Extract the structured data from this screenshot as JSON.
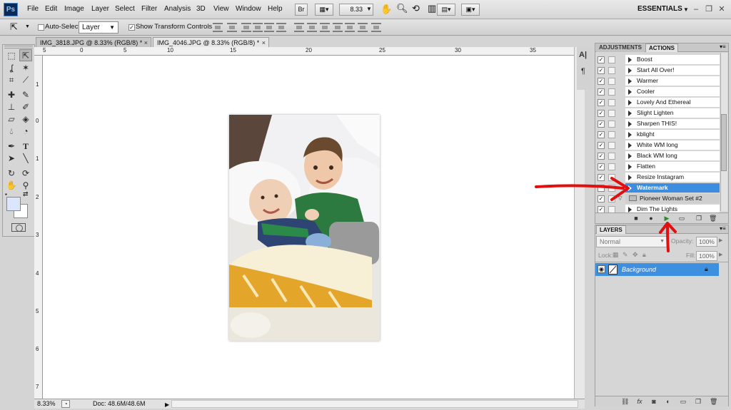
{
  "app": {
    "logo": "Ps",
    "workspace": "ESSENTIALS"
  },
  "menu": [
    "File",
    "Edit",
    "Image",
    "Layer",
    "Select",
    "Filter",
    "Analysis",
    "3D",
    "View",
    "Window",
    "Help"
  ],
  "menubar_controls": {
    "bridge": "Br",
    "zoom": "8.33"
  },
  "options": {
    "auto_select_label": "Auto-Select:",
    "auto_select_value": "Layer",
    "show_transform_label": "Show Transform Controls"
  },
  "tabs": [
    {
      "label": "IMG_3818.JPG @ 8.33% (RGB/8) *",
      "close": "×"
    },
    {
      "label": "IMG_4046.JPG @ 8.33% (RGB/8) *",
      "close": "×"
    }
  ],
  "rulers": {
    "h": [
      "5",
      "0",
      "5",
      "10",
      "15",
      "20",
      "25",
      "30",
      "35"
    ],
    "v": [
      "1",
      "0",
      "1",
      "2",
      "3",
      "4",
      "5",
      "6",
      "7"
    ]
  },
  "status": {
    "zoom": "8.33%",
    "doc": "Doc: 48.6M/48.6M"
  },
  "panels": {
    "adjustments_tab": "ADJUSTMENTS",
    "actions_tab": "ACTIONS",
    "layers_tab": "LAYERS"
  },
  "actions": [
    {
      "label": "Boost",
      "checked": true
    },
    {
      "label": "Start All Over!",
      "checked": true
    },
    {
      "label": "Warmer",
      "checked": true
    },
    {
      "label": "Cooler",
      "checked": true
    },
    {
      "label": "Lovely And Ethereal",
      "checked": true
    },
    {
      "label": "Slight Lighten",
      "checked": true
    },
    {
      "label": "Sharpen THIS!",
      "checked": true
    },
    {
      "label": "kblight",
      "checked": true
    },
    {
      "label": "White WM long",
      "checked": true
    },
    {
      "label": "Black WM long",
      "checked": true
    },
    {
      "label": "Flatten",
      "checked": true
    },
    {
      "label": "Resize Instagram",
      "checked": true
    },
    {
      "label": "Watermark",
      "checked": false,
      "selected": true
    },
    {
      "label": "Pioneer Woman Set #2",
      "checked": true,
      "set": true
    },
    {
      "label": "Dim The Lights",
      "checked": true
    }
  ],
  "layers": {
    "blend_mode": "Normal",
    "opacity_label": "Opacity:",
    "opacity_value": "100%",
    "lock_label": "Lock:",
    "fill_label": "Fill:",
    "fill_value": "100%",
    "items": [
      {
        "name": "Background",
        "visible": true,
        "locked": true
      }
    ]
  },
  "colors": {
    "selection": "#3c8de0",
    "annotation_arrow": "#e01010",
    "foreground": "#dce6fb",
    "background": "#ffffff"
  }
}
